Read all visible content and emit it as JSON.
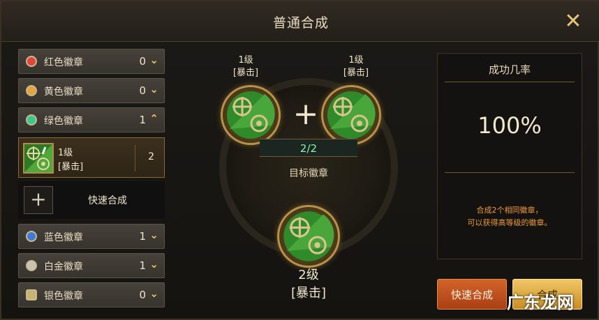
{
  "window": {
    "title": "普通合成"
  },
  "sidebar": {
    "categories": [
      {
        "label": "红色徽章",
        "count": "0",
        "chevron": "⌄",
        "color": "#e0463c"
      },
      {
        "label": "黄色徽章",
        "count": "0",
        "chevron": "⌄",
        "color": "#e4a63a"
      },
      {
        "label": "绿色徽章",
        "count": "1",
        "chevron": "⌃",
        "color": "#37c98e"
      },
      {
        "label": "蓝色徽章",
        "count": "1",
        "chevron": "⌄",
        "color": "#3b7be0"
      },
      {
        "label": "白金徽章",
        "count": "1",
        "chevron": "⌄",
        "color": "#c9c2b4"
      },
      {
        "label": "银色徽章",
        "count": "0",
        "chevron": "⌄",
        "color": "#c9b271"
      }
    ],
    "badge_item": {
      "level": "1级",
      "type": "[暴击]",
      "quantity": "2"
    },
    "quick_merge": {
      "plus": "+",
      "label": "快速合成"
    }
  },
  "center": {
    "left_slot": {
      "level": "1级",
      "type": "[暴击]"
    },
    "right_slot": {
      "level": "1级",
      "type": "[暴击]"
    },
    "plus": "+",
    "progress": "2/2",
    "target_label": "目标徽章",
    "result": {
      "level": "2级",
      "type": "[暴击]"
    }
  },
  "info": {
    "header": "成功几率",
    "rate": "100%",
    "note_line1": "合成2个相同徽章，",
    "note_line2": "可以获得高等级的徽章。"
  },
  "buttons": {
    "quick": "快速合成",
    "merge": "合成"
  },
  "watermark": "广东龙网",
  "colors": {
    "accent_gold": "#c9a05a",
    "emblem_green": "#2f8a2a",
    "note_orange": "#ec9a3a"
  }
}
